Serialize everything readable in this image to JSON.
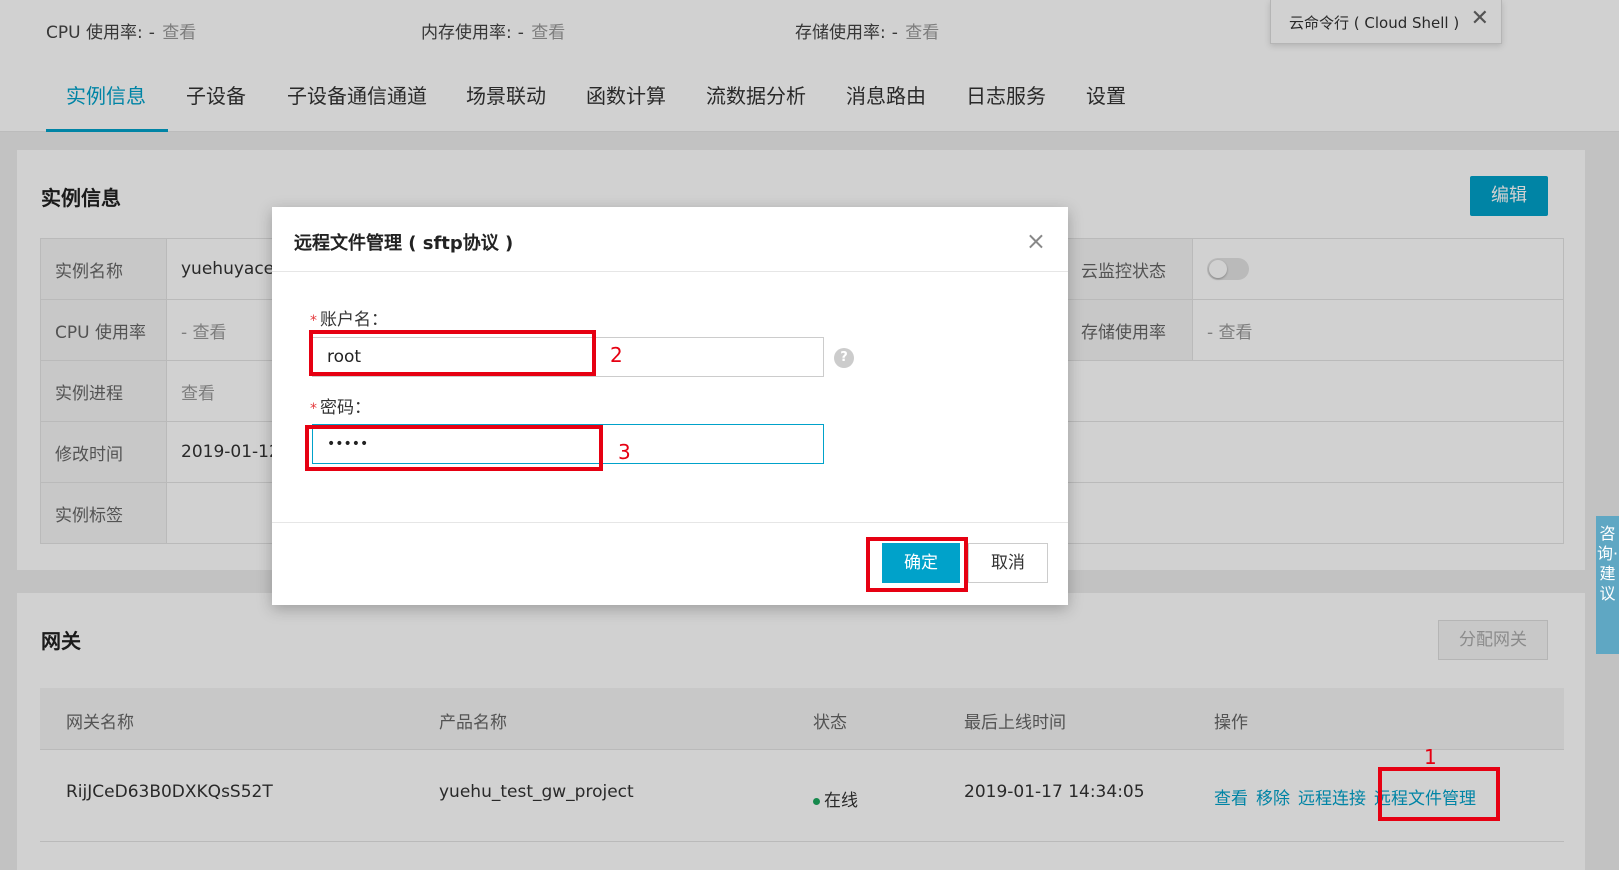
{
  "metrics": [
    {
      "label": "CPU 使用率:",
      "dash": "-",
      "link": "查看"
    },
    {
      "label": "内存使用率:",
      "dash": "-",
      "link": "查看"
    },
    {
      "label": "存储使用率:",
      "dash": "-",
      "link": "查看"
    }
  ],
  "cloud_shell": {
    "label": "云命令行 ( Cloud Shell )",
    "close": "✕"
  },
  "tabs": [
    "实例信息",
    "子设备",
    "子设备通信通道",
    "场景联动",
    "函数计算",
    "流数据分析",
    "消息路由",
    "日志服务",
    "设置"
  ],
  "instance": {
    "title": "实例信息",
    "edit_label": "编辑",
    "rows": [
      {
        "k1": "实例名称",
        "v1": "yuehuyace-",
        "k2": "云监控状态",
        "v2": ""
      },
      {
        "k1": "CPU 使用率",
        "v1": "- 查看",
        "k2": "存储使用率",
        "v2": "- 查看"
      },
      {
        "k1": "实例进程",
        "v1": "查看",
        "k2": "",
        "v2": ""
      },
      {
        "k1": "修改时间",
        "v1": "2019-01-12",
        "k2": "",
        "v2": ""
      },
      {
        "k1": "实例标签",
        "v1": "",
        "k2": "",
        "v2": ""
      }
    ]
  },
  "gateway": {
    "title": "网关",
    "assign_label": "分配网关",
    "headers": [
      "网关名称",
      "产品名称",
      "状态",
      "最后上线时间",
      "操作"
    ],
    "row": {
      "name": "RijJCeD63B0DXKQsS52T",
      "product": "yuehu_test_gw_project",
      "status": "在线",
      "last_online": "2019-01-17 14:34:05",
      "ops": [
        "查看",
        "移除",
        "远程连接",
        "远程文件管理"
      ]
    }
  },
  "feedback_label": "咨询·建议",
  "modal": {
    "title": "远程文件管理 ( sftp协议 )",
    "close": "×",
    "account_label": "账户名：",
    "account_value": "root",
    "password_label": "密码：",
    "password_value": "•••••",
    "required_mark": "*",
    "help": "?",
    "ok_label": "确定",
    "cancel_label": "取消"
  },
  "annotations": [
    "1",
    "2",
    "3"
  ],
  "colors": {
    "accent": "#00a2ca",
    "annotation": "#e60012",
    "online": "#1ca85e"
  }
}
